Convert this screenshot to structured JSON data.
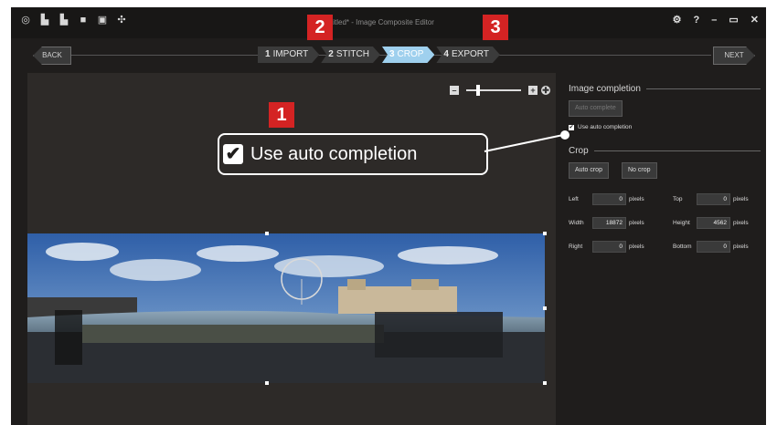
{
  "window": {
    "title": "titled* - Image Composite Editor",
    "controls": [
      "⚙",
      "?",
      "–",
      "▭",
      "✕"
    ]
  },
  "toolbar_icons": [
    "new-icon",
    "open-icon",
    "save-icon",
    "folder-icon",
    "export-icon",
    "settings-icon"
  ],
  "nav": {
    "back_label": "BACK",
    "next_label": "NEXT",
    "steps": [
      {
        "num": "1",
        "label": "IMPORT"
      },
      {
        "num": "2",
        "label": "STITCH"
      },
      {
        "num": "3",
        "label": "CROP"
      },
      {
        "num": "4",
        "label": "EXPORT"
      }
    ],
    "active_step": 2
  },
  "zoom": {
    "minus": "–",
    "plus": "+",
    "level": 0.2
  },
  "panel": {
    "image_completion": {
      "heading": "Image completion",
      "auto_complete_label": "Auto complete",
      "checkbox_label": "Use auto completion"
    },
    "crop": {
      "heading": "Crop",
      "auto_crop_label": "Auto crop",
      "no_crop_label": "No crop",
      "fields": {
        "left": {
          "label": "Left",
          "value": "0",
          "unit": "pixels"
        },
        "top": {
          "label": "Top",
          "value": "0",
          "unit": "pixels"
        },
        "width": {
          "label": "Width",
          "value": "18872",
          "unit": "pixels"
        },
        "height": {
          "label": "Height",
          "value": "4562",
          "unit": "pixels"
        },
        "right": {
          "label": "Right",
          "value": "0",
          "unit": "pixels"
        },
        "bottom": {
          "label": "Bottom",
          "value": "0",
          "unit": "pixels"
        }
      }
    }
  },
  "callout": {
    "text": "Use auto completion",
    "check": "✔"
  },
  "badges": [
    "1",
    "2",
    "3"
  ],
  "colors": {
    "accent": "#9fd0ee",
    "badge": "#d42323",
    "background": "#1f1d1c"
  }
}
